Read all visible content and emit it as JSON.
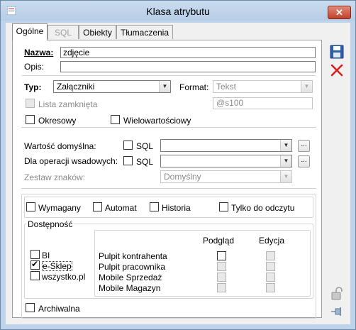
{
  "window": {
    "title": "Klasa atrybutu",
    "close_label": "✕"
  },
  "tabs": [
    {
      "label": "Ogólne"
    },
    {
      "label": "SQL"
    },
    {
      "label": "Obiekty"
    },
    {
      "label": "Tłumaczenia"
    }
  ],
  "form": {
    "nazwa_label": "Nazwa:",
    "nazwa_value": "zdjęcie",
    "opis_label": "Opis:",
    "opis_value": "",
    "typ_label": "Typ:",
    "typ_value": "Załączniki",
    "format_label": "Format:",
    "format_value": "Tekst",
    "lista_zamknieta_label": "Lista zamknięta",
    "format_mask": "@s100",
    "okresowy_label": "Okresowy",
    "wielowartosciowy_label": "Wielowartościowy",
    "wartosc_domyslna_label": "Wartość domyślna:",
    "dla_operacji_label": "Dla operacji wsadowych:",
    "sql_label": "SQL",
    "ellipsis_label": "...",
    "zestaw_znakow_label": "Zestaw znaków:",
    "zestaw_znakow_value": "Domyślny",
    "wymagany_label": "Wymagany",
    "automat_label": "Automat",
    "historia_label": "Historia",
    "tylko_do_odczytu_label": "Tylko do odczytu",
    "dostepnosc_label": "Dostępność",
    "archiwalna_label": "Archiwalna"
  },
  "availability": {
    "systems": [
      {
        "label": "BI",
        "checked": false
      },
      {
        "label": "e-Sklep",
        "checked": true
      },
      {
        "label": "wszystko.pl",
        "checked": false
      }
    ],
    "columns": {
      "podglad": "Podgląd",
      "edycja": "Edycja"
    },
    "rows": [
      {
        "label": "Pulpit kontrahenta",
        "podglad_enabled": true,
        "edycja_enabled": false
      },
      {
        "label": "Pulpit pracownika",
        "podglad_enabled": false,
        "edycja_enabled": false
      },
      {
        "label": "Mobile Sprzedaż",
        "podglad_enabled": false,
        "edycja_enabled": false
      },
      {
        "label": "Mobile Magazyn",
        "podglad_enabled": false,
        "edycja_enabled": false
      }
    ]
  },
  "side_buttons": {
    "save_icon": "save-icon",
    "delete_icon": "delete-icon",
    "lock_icon": "lock-icon",
    "pin_icon": "pin-icon"
  },
  "colors": {
    "title_bg": "#bcd3ea",
    "close_btn": "#c2422a",
    "delete_x": "#d42020",
    "save_blue": "#2f5ea8"
  }
}
